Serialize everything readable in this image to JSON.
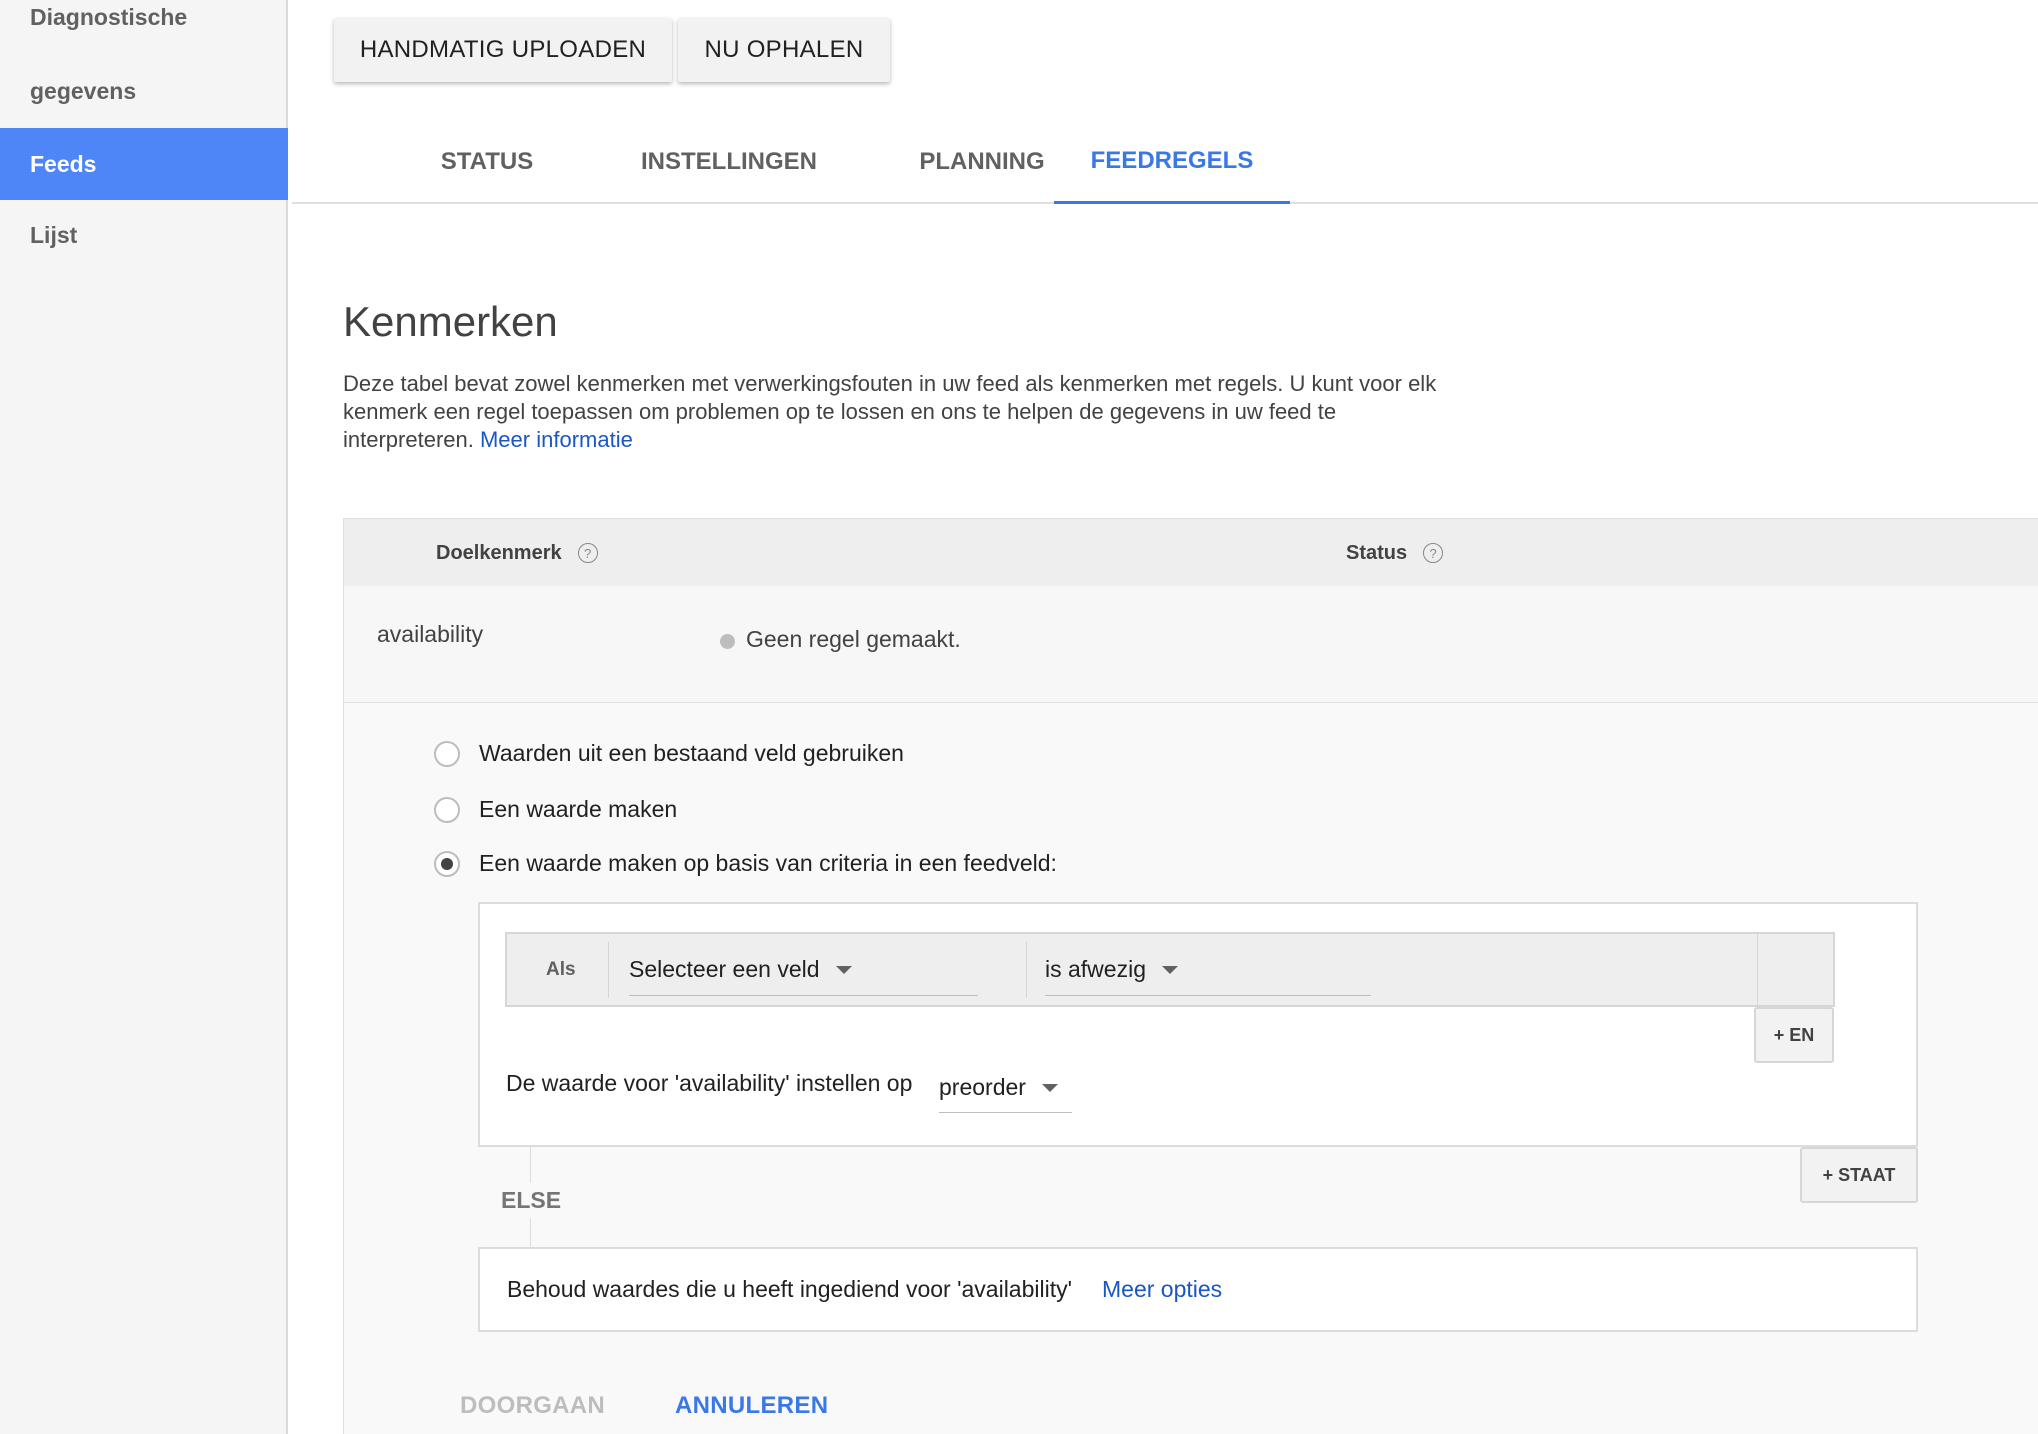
{
  "sidebar": {
    "items": [
      {
        "label": "Diagnostische"
      },
      {
        "label": "gegevens"
      },
      {
        "label": "Feeds",
        "active": true
      },
      {
        "label": "Lijst"
      }
    ]
  },
  "toolbar": {
    "upload_label": "HANDMATIG UPLOADEN",
    "fetch_label": "NU OPHALEN"
  },
  "tabs": [
    {
      "label": "STATUS"
    },
    {
      "label": "INSTELLINGEN"
    },
    {
      "label": "PLANNING"
    },
    {
      "label": "FEEDREGELS",
      "active": true
    }
  ],
  "main": {
    "title": "Kenmerken",
    "description": "Deze tabel bevat zowel kenmerken met verwerkingsfouten in uw feed als kenmerken met regels. U kunt voor elk kenmerk een regel toepassen om problemen op te lossen en ons te helpen de gegevens in uw feed te interpreteren.",
    "more_info_link": "Meer informatie"
  },
  "table": {
    "headers": {
      "target": "Doelkenmerk",
      "status": "Status",
      "help_glyph": "?"
    },
    "row": {
      "attribute": "availability",
      "status": "Geen regel gemaakt."
    }
  },
  "rule_options": [
    {
      "label": "Waarden uit een bestaand veld gebruiken",
      "checked": false
    },
    {
      "label": "Een waarde maken",
      "checked": false
    },
    {
      "label": "Een waarde maken op basis van criteria in een feedveld:",
      "checked": true
    }
  ],
  "condition": {
    "if_label": "Als",
    "field_select": "Selecteer een veld",
    "operator_select": "is afwezig",
    "and_button": "+ EN"
  },
  "set_value": {
    "label": "De waarde voor 'availability' instellen op",
    "value": "preorder"
  },
  "state_button": "+ STAAT",
  "else": {
    "label": "ELSE",
    "text": "Behoud waardes die u heeft ingediend voor 'availability'",
    "more_options": "Meer opties"
  },
  "actions": {
    "continue": "DOORGAAN",
    "cancel": "ANNULEREN"
  },
  "colors": {
    "accent": "#3b78e7",
    "sidebar_active": "#4f86f7",
    "link": "#1a57c4",
    "disabled": "#bdbdbd"
  }
}
